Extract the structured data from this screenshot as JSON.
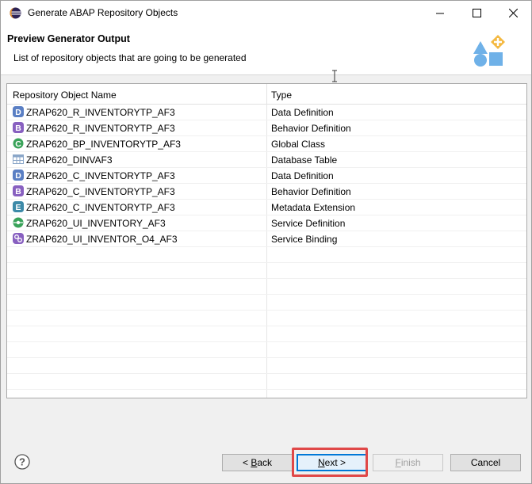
{
  "window": {
    "title": "Generate ABAP Repository Objects"
  },
  "header": {
    "title": "Preview Generator Output",
    "description": "List of repository objects that are going to be generated"
  },
  "table": {
    "columns": [
      "Repository Object Name",
      "Type"
    ],
    "rows": [
      {
        "name": "ZRAP620_R_INVENTORYTP_AF3",
        "type": "Data Definition",
        "icon": "data-definition-icon",
        "letter": "D",
        "color": "#5a7fc4"
      },
      {
        "name": "ZRAP620_R_INVENTORYTP_AF3",
        "type": "Behavior Definition",
        "icon": "behavior-definition-icon",
        "letter": "B",
        "color": "#8860c0"
      },
      {
        "name": "ZRAP620_BP_INVENTORYTP_AF3",
        "type": "Global Class",
        "icon": "global-class-icon",
        "letter": "C",
        "color": "#3aa35a"
      },
      {
        "name": "ZRAP620_DINVAF3",
        "type": "Database Table",
        "icon": "database-table-icon",
        "letter": "",
        "color": "#8aa6c8"
      },
      {
        "name": "ZRAP620_C_INVENTORYTP_AF3",
        "type": "Data Definition",
        "icon": "data-definition-icon",
        "letter": "D",
        "color": "#5a7fc4"
      },
      {
        "name": "ZRAP620_C_INVENTORYTP_AF3",
        "type": "Behavior Definition",
        "icon": "behavior-definition-icon",
        "letter": "B",
        "color": "#8860c0"
      },
      {
        "name": "ZRAP620_C_INVENTORYTP_AF3",
        "type": "Metadata Extension",
        "icon": "metadata-extension-icon",
        "letter": "E",
        "color": "#3d8aa8"
      },
      {
        "name": "ZRAP620_UI_INVENTORY_AF3",
        "type": "Service Definition",
        "icon": "service-definition-icon",
        "letter": "",
        "color": "#3aa35a"
      },
      {
        "name": "ZRAP620_UI_INVENTOR_O4_AF3",
        "type": "Service Binding",
        "icon": "service-binding-icon",
        "letter": "",
        "color": "#8860c0"
      }
    ],
    "empty_row_count": 10
  },
  "footer": {
    "back": {
      "prefix": "< ",
      "mnemonic": "B",
      "rest": "ack"
    },
    "next": {
      "mnemonic": "N",
      "rest": "ext >"
    },
    "finish": {
      "mnemonic": "F",
      "rest": "inish"
    },
    "cancel": "Cancel"
  },
  "colors": {
    "highlight": "#e04848",
    "focus": "#0078d7"
  }
}
